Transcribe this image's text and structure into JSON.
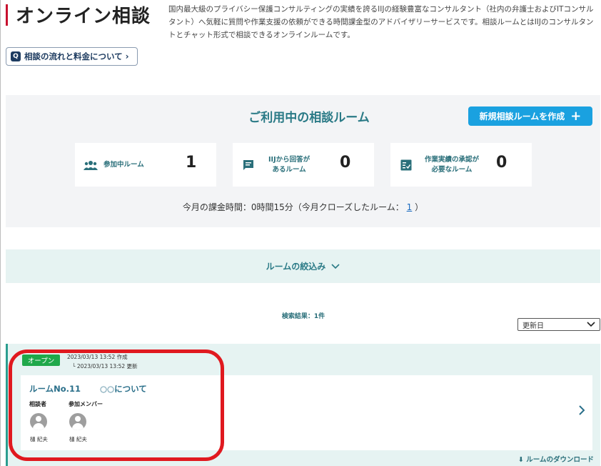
{
  "header": {
    "title": "オンライン相談",
    "description_lines": [
      "国内最大級のプライバシー保護コンサルティングの実績を誇るIIJの経験豊富なコンサルタント（社内の弁護士およびITコンサル",
      "タント）へ気軽に質問や作業支援の依頼ができる時間課金型のアドバイザリーサービスです。相談ルームとはIIJのコンサルタン",
      "トとチャット形式で相談できるオンラインルームです。"
    ],
    "flow_link": "相談の流れと料金について"
  },
  "rooms": {
    "heading": "ご利用中の相談ルーム",
    "create_label": "新規相談ルームを作成",
    "stats": [
      {
        "label": [
          "参加中ルーム"
        ],
        "value": "1",
        "icon": "people-icon"
      },
      {
        "label": [
          "IIJから回答が",
          "あるルーム"
        ],
        "value": "0",
        "icon": "chat-icon"
      },
      {
        "label": [
          "作業実績の承認が",
          "必要なルーム"
        ],
        "value": "0",
        "icon": "checklist-icon"
      }
    ],
    "billing_prefix": "今月の課金時間：0時間15分（今月クローズしたルーム：",
    "billing_count": "1",
    "billing_suffix": "）"
  },
  "filter": {
    "label": "ルームの絞込み",
    "results": "検索結果：1件",
    "sort_value": "更新日"
  },
  "room_list": [
    {
      "status": "オープン",
      "created": "2023/03/13 13:52 作成",
      "updated": "└ 2023/03/13 13:52 更新",
      "room_no": "ルームNo.11",
      "topic": "○○について",
      "consultant_label": "相談者",
      "members_label": "参加メンバー",
      "consultant_name": "樋 紀夫",
      "member_name": "樋 紀夫",
      "download_label": "ルームのダウンロード"
    }
  ],
  "colors": {
    "accent": "#1aa1e0",
    "teal": "#2a7a86",
    "open_green": "#1fa84a",
    "highlight_red": "#e0191f"
  }
}
